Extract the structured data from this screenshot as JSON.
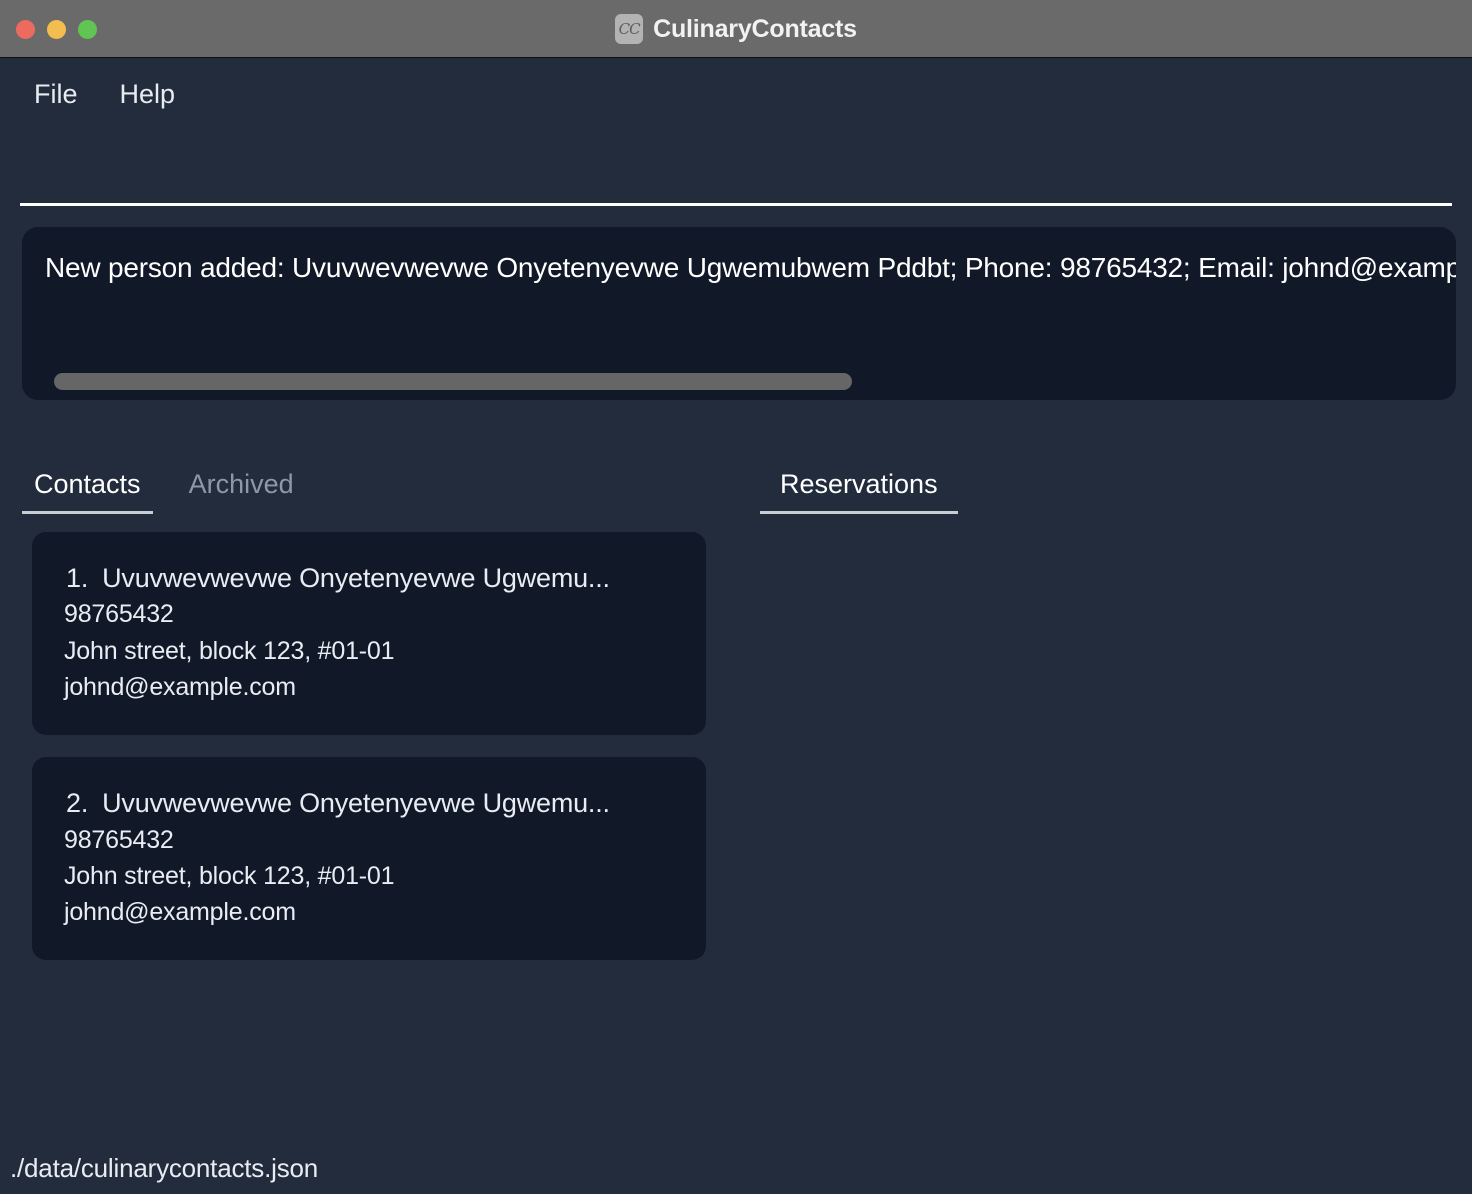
{
  "window": {
    "title": "CulinaryContacts",
    "app_icon": "CC",
    "traffic_lights": [
      {
        "name": "close",
        "color": "#ed6a5e"
      },
      {
        "name": "minimize",
        "color": "#f4bd4f"
      },
      {
        "name": "maximize",
        "color": "#61c554"
      }
    ]
  },
  "menubar": {
    "items": [
      {
        "label": "File"
      },
      {
        "label": "Help"
      }
    ]
  },
  "result_panel": {
    "text": "New person added: Uvuvwevwevwe Onyetenyevwe Ugwemubwem Pddbt; Phone: 98765432; Email: johnd@example.com",
    "scrollbar": "horizontal"
  },
  "left_panel": {
    "tabs": [
      {
        "label": "Contacts",
        "active": true
      },
      {
        "label": "Archived",
        "active": false
      }
    ],
    "contacts": [
      {
        "index": "1.",
        "name": "Uvuvwevwevwe Onyetenyevwe Ugwemu...",
        "phone": "98765432",
        "address": "John street, block 123, #01-01",
        "email": "johnd@example.com"
      },
      {
        "index": "2.",
        "name": "Uvuvwevwevwe Onyetenyevwe Ugwemu...",
        "phone": "98765432",
        "address": "John street, block 123, #01-01",
        "email": "johnd@example.com"
      }
    ]
  },
  "right_panel": {
    "tabs": [
      {
        "label": "Reservations",
        "active": true
      }
    ],
    "items": []
  },
  "statusbar": {
    "file_path": "./data/culinarycontacts.json"
  },
  "colors": {
    "window_background": "#222c3c",
    "panel_background": "#111827",
    "titlebar": "#6a6a6a",
    "text_primary": "#e9edf3",
    "text_muted": "#8d97a6",
    "accent_underline": "#c9ccd1",
    "scrollbar_thumb": "#666666"
  }
}
